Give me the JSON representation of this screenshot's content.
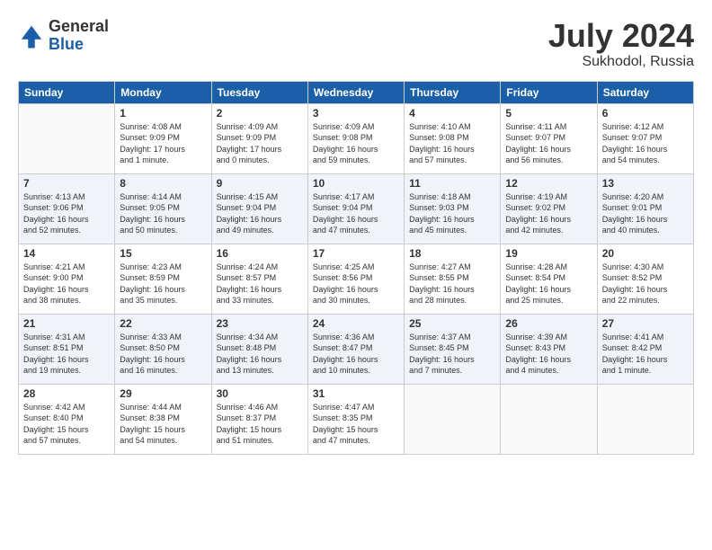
{
  "header": {
    "logo_general": "General",
    "logo_blue": "Blue",
    "title": "July 2024",
    "location": "Sukhodol, Russia"
  },
  "weekdays": [
    "Sunday",
    "Monday",
    "Tuesday",
    "Wednesday",
    "Thursday",
    "Friday",
    "Saturday"
  ],
  "weeks": [
    [
      {
        "day": "",
        "info": ""
      },
      {
        "day": "1",
        "info": "Sunrise: 4:08 AM\nSunset: 9:09 PM\nDaylight: 17 hours\nand 1 minute."
      },
      {
        "day": "2",
        "info": "Sunrise: 4:09 AM\nSunset: 9:09 PM\nDaylight: 17 hours\nand 0 minutes."
      },
      {
        "day": "3",
        "info": "Sunrise: 4:09 AM\nSunset: 9:08 PM\nDaylight: 16 hours\nand 59 minutes."
      },
      {
        "day": "4",
        "info": "Sunrise: 4:10 AM\nSunset: 9:08 PM\nDaylight: 16 hours\nand 57 minutes."
      },
      {
        "day": "5",
        "info": "Sunrise: 4:11 AM\nSunset: 9:07 PM\nDaylight: 16 hours\nand 56 minutes."
      },
      {
        "day": "6",
        "info": "Sunrise: 4:12 AM\nSunset: 9:07 PM\nDaylight: 16 hours\nand 54 minutes."
      }
    ],
    [
      {
        "day": "7",
        "info": "Sunrise: 4:13 AM\nSunset: 9:06 PM\nDaylight: 16 hours\nand 52 minutes."
      },
      {
        "day": "8",
        "info": "Sunrise: 4:14 AM\nSunset: 9:05 PM\nDaylight: 16 hours\nand 50 minutes."
      },
      {
        "day": "9",
        "info": "Sunrise: 4:15 AM\nSunset: 9:04 PM\nDaylight: 16 hours\nand 49 minutes."
      },
      {
        "day": "10",
        "info": "Sunrise: 4:17 AM\nSunset: 9:04 PM\nDaylight: 16 hours\nand 47 minutes."
      },
      {
        "day": "11",
        "info": "Sunrise: 4:18 AM\nSunset: 9:03 PM\nDaylight: 16 hours\nand 45 minutes."
      },
      {
        "day": "12",
        "info": "Sunrise: 4:19 AM\nSunset: 9:02 PM\nDaylight: 16 hours\nand 42 minutes."
      },
      {
        "day": "13",
        "info": "Sunrise: 4:20 AM\nSunset: 9:01 PM\nDaylight: 16 hours\nand 40 minutes."
      }
    ],
    [
      {
        "day": "14",
        "info": "Sunrise: 4:21 AM\nSunset: 9:00 PM\nDaylight: 16 hours\nand 38 minutes."
      },
      {
        "day": "15",
        "info": "Sunrise: 4:23 AM\nSunset: 8:59 PM\nDaylight: 16 hours\nand 35 minutes."
      },
      {
        "day": "16",
        "info": "Sunrise: 4:24 AM\nSunset: 8:57 PM\nDaylight: 16 hours\nand 33 minutes."
      },
      {
        "day": "17",
        "info": "Sunrise: 4:25 AM\nSunset: 8:56 PM\nDaylight: 16 hours\nand 30 minutes."
      },
      {
        "day": "18",
        "info": "Sunrise: 4:27 AM\nSunset: 8:55 PM\nDaylight: 16 hours\nand 28 minutes."
      },
      {
        "day": "19",
        "info": "Sunrise: 4:28 AM\nSunset: 8:54 PM\nDaylight: 16 hours\nand 25 minutes."
      },
      {
        "day": "20",
        "info": "Sunrise: 4:30 AM\nSunset: 8:52 PM\nDaylight: 16 hours\nand 22 minutes."
      }
    ],
    [
      {
        "day": "21",
        "info": "Sunrise: 4:31 AM\nSunset: 8:51 PM\nDaylight: 16 hours\nand 19 minutes."
      },
      {
        "day": "22",
        "info": "Sunrise: 4:33 AM\nSunset: 8:50 PM\nDaylight: 16 hours\nand 16 minutes."
      },
      {
        "day": "23",
        "info": "Sunrise: 4:34 AM\nSunset: 8:48 PM\nDaylight: 16 hours\nand 13 minutes."
      },
      {
        "day": "24",
        "info": "Sunrise: 4:36 AM\nSunset: 8:47 PM\nDaylight: 16 hours\nand 10 minutes."
      },
      {
        "day": "25",
        "info": "Sunrise: 4:37 AM\nSunset: 8:45 PM\nDaylight: 16 hours\nand 7 minutes."
      },
      {
        "day": "26",
        "info": "Sunrise: 4:39 AM\nSunset: 8:43 PM\nDaylight: 16 hours\nand 4 minutes."
      },
      {
        "day": "27",
        "info": "Sunrise: 4:41 AM\nSunset: 8:42 PM\nDaylight: 16 hours\nand 1 minute."
      }
    ],
    [
      {
        "day": "28",
        "info": "Sunrise: 4:42 AM\nSunset: 8:40 PM\nDaylight: 15 hours\nand 57 minutes."
      },
      {
        "day": "29",
        "info": "Sunrise: 4:44 AM\nSunset: 8:38 PM\nDaylight: 15 hours\nand 54 minutes."
      },
      {
        "day": "30",
        "info": "Sunrise: 4:46 AM\nSunset: 8:37 PM\nDaylight: 15 hours\nand 51 minutes."
      },
      {
        "day": "31",
        "info": "Sunrise: 4:47 AM\nSunset: 8:35 PM\nDaylight: 15 hours\nand 47 minutes."
      },
      {
        "day": "",
        "info": ""
      },
      {
        "day": "",
        "info": ""
      },
      {
        "day": "",
        "info": ""
      }
    ]
  ]
}
